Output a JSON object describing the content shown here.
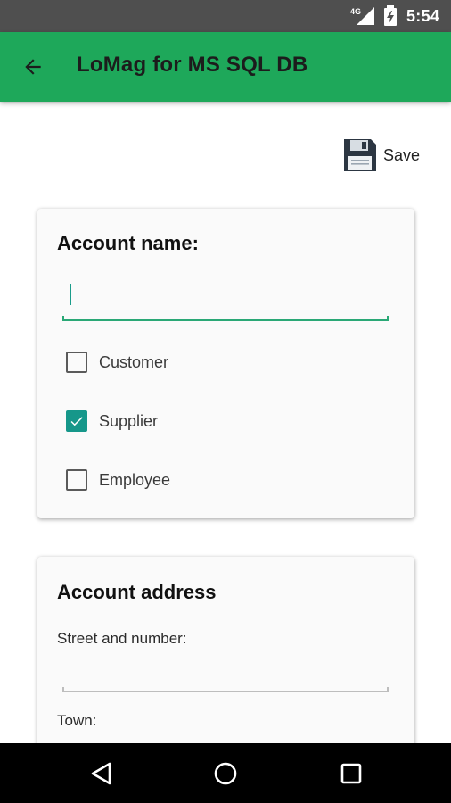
{
  "status_bar": {
    "network": "4G",
    "time": "5:54",
    "icons": [
      "signal-icon",
      "battery-charging-icon"
    ]
  },
  "app_bar": {
    "title": "LoMag for MS SQL DB",
    "back_icon": "arrow-back-icon",
    "color": "#1ea85a"
  },
  "toolbar": {
    "save_label": "Save",
    "save_icon": "floppy-disk-icon"
  },
  "account_name_card": {
    "title": "Account name:",
    "input_value": "",
    "checkboxes": [
      {
        "label": "Customer",
        "checked": false
      },
      {
        "label": "Supplier",
        "checked": true
      },
      {
        "label": "Employee",
        "checked": false
      }
    ],
    "accent_color": "#16978a"
  },
  "account_address_card": {
    "title": "Account address",
    "fields": [
      {
        "label": "Street and number:",
        "value": ""
      },
      {
        "label": "Town:",
        "value": ""
      }
    ]
  },
  "nav_bar": {
    "buttons": [
      "back-triangle-icon",
      "home-circle-icon",
      "recents-square-icon"
    ]
  }
}
